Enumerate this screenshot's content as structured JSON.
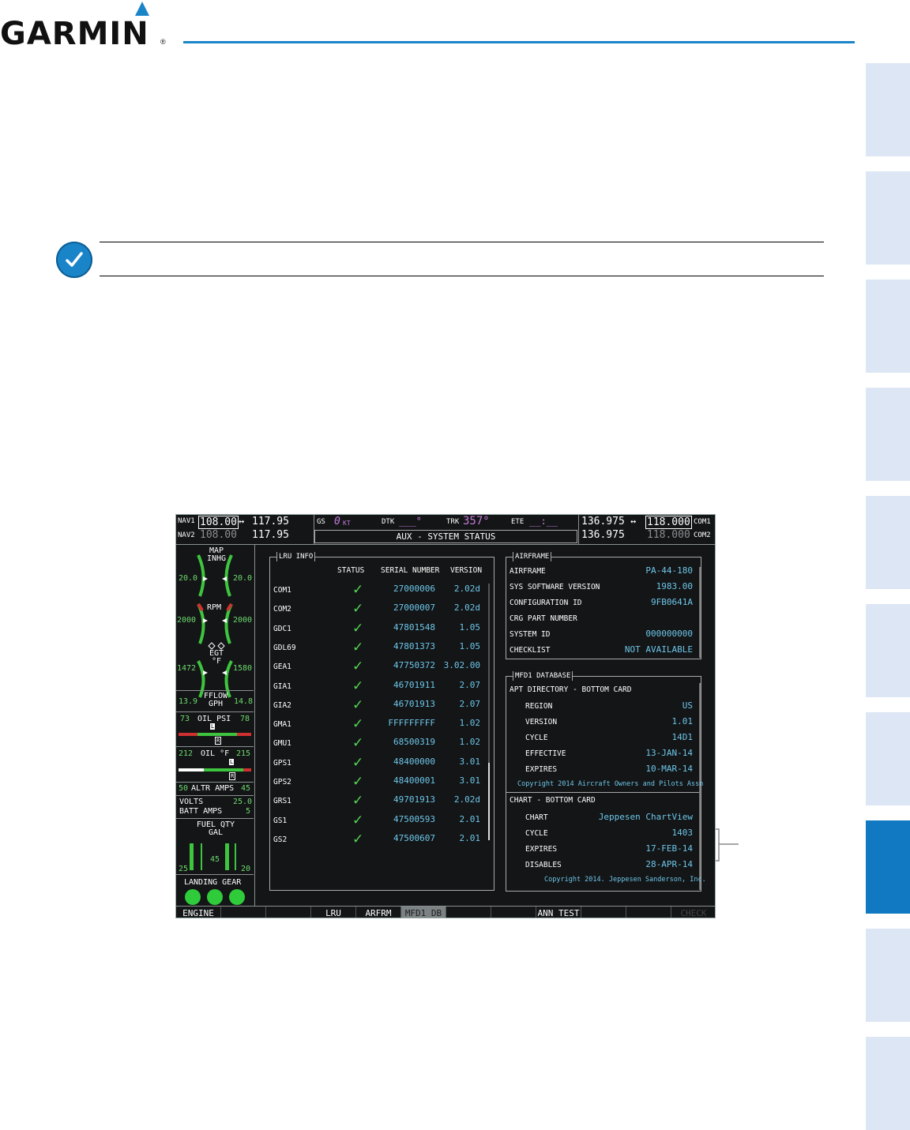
{
  "brand": {
    "name": "GARMIN",
    "reg": "®"
  },
  "colors": {
    "accent": "#1a84c8",
    "tab": "#dde6f4",
    "tab_active": "#1079c1",
    "screen_bg": "#131516",
    "cyan": "#6ec6ea",
    "magenta": "#c57ad9",
    "green": "#6fdb6f"
  },
  "icons": {
    "note": "check-mark-icon",
    "swap": "↔"
  },
  "header": {
    "nav1_label": "NAV1",
    "nav1_active": "108.00",
    "nav1_standby": "117.95",
    "nav2_label": "NAV2",
    "nav2_active": "108.00",
    "nav2_standby": "117.95",
    "gs_label": "GS",
    "gs_value": "0",
    "gs_unit": "KT",
    "dtk_label": "DTK",
    "dtk_value": "___°",
    "trk_label": "TRK",
    "trk_value": "357°",
    "ete_label": "ETE",
    "ete_value": "__:__",
    "com1_standby": "136.975",
    "com1_active": "118.000",
    "com1_label": "COM1",
    "com2_standby": "136.975",
    "com2_active": "118.000",
    "com2_label": "COM2",
    "page_title": "AUX - SYSTEM STATUS"
  },
  "eis": {
    "map_inhg_label": "MAP\nINHG",
    "map_left": "20.0",
    "map_right": "20.0",
    "rpm_label": "RPM",
    "rpm_left": "2000",
    "rpm_right": "2000",
    "egt_label": "EGT\n°F",
    "egt_left": "1472",
    "egt_right": "1580",
    "fflow_label": "FFLOW\nGPH",
    "fflow_left": "13.9",
    "fflow_right": "14.8",
    "oilpsi_left": "73",
    "oilpsi_label": "OIL PSI",
    "oilpsi_right": "78",
    "oiltemp_left": "212",
    "oiltemp_label": "OIL °F",
    "oiltemp_right": "215",
    "marker_l": "L",
    "marker_r": "R",
    "altr_left": "50",
    "altr_label": "ALTR AMPS",
    "altr_right": "45",
    "volts_label": "VOLTS",
    "volts_value": "25.0",
    "batt_label": "BATT AMPS",
    "batt_value": "5",
    "fuel_label": "FUEL QTY\nGAL",
    "fuel_left": "25",
    "fuel_mid": "45",
    "fuel_right": "20",
    "gear_label": "LANDING GEAR"
  },
  "lru": {
    "title": "LRU INFO",
    "headers": {
      "status": "STATUS",
      "serial": "SERIAL NUMBER",
      "version": "VERSION"
    },
    "rows": [
      {
        "name": "COM1",
        "serial": "27000006",
        "version": "2.02d"
      },
      {
        "name": "COM2",
        "serial": "27000007",
        "version": "2.02d"
      },
      {
        "name": "GDC1",
        "serial": "47801548",
        "version": "1.05"
      },
      {
        "name": "GDL69",
        "serial": "47801373",
        "version": "1.05"
      },
      {
        "name": "GEA1",
        "serial": "47750372",
        "version": "3.02.00"
      },
      {
        "name": "GIA1",
        "serial": "46701911",
        "version": "2.07"
      },
      {
        "name": "GIA2",
        "serial": "46701913",
        "version": "2.07"
      },
      {
        "name": "GMA1",
        "serial": "FFFFFFFFF",
        "version": "1.02"
      },
      {
        "name": "GMU1",
        "serial": "68500319",
        "version": "1.02"
      },
      {
        "name": "GPS1",
        "serial": "48400000",
        "version": "3.01"
      },
      {
        "name": "GPS2",
        "serial": "48400001",
        "version": "3.01"
      },
      {
        "name": "GRS1",
        "serial": "49701913",
        "version": "2.02d"
      },
      {
        "name": "GS1",
        "serial": "47500593",
        "version": "2.01"
      },
      {
        "name": "GS2",
        "serial": "47500607",
        "version": "2.01"
      }
    ]
  },
  "airframe": {
    "title": "AIRFRAME",
    "rows": [
      {
        "label": "AIRFRAME",
        "value": "PA-44-180"
      },
      {
        "label": "SYS SOFTWARE VERSION",
        "value": "1983.00"
      },
      {
        "label": "CONFIGURATION ID",
        "value": "9FB0641A"
      },
      {
        "label": "CRG PART NUMBER",
        "value": ""
      },
      {
        "label": "SYSTEM ID",
        "value": "000000000"
      },
      {
        "label": "CHECKLIST",
        "value": "NOT AVAILABLE"
      }
    ]
  },
  "mfd_db": {
    "title": "MFD1 DATABASE",
    "apt_header": "APT DIRECTORY - BOTTOM CARD",
    "apt_rows": [
      {
        "label": "REGION",
        "value": "US"
      },
      {
        "label": "VERSION",
        "value": "1.01"
      },
      {
        "label": "CYCLE",
        "value": "14D1"
      },
      {
        "label": "EFFECTIVE",
        "value": "13-JAN-14"
      },
      {
        "label": "EXPIRES",
        "value": "10-MAR-14"
      }
    ],
    "apt_copyright": "Copyright 2014 Aircraft Owners and Pilots Assn",
    "chart_header": "CHART - BOTTOM CARD",
    "chart_rows": [
      {
        "label": "CHART",
        "value": "Jeppesen ChartView"
      },
      {
        "label": "CYCLE",
        "value": "1403"
      },
      {
        "label": "EXPIRES",
        "value": "17-FEB-14"
      },
      {
        "label": "DISABLES",
        "value": "28-APR-14"
      }
    ],
    "chart_copyright": "Copyright 2014. Jeppesen Sanderson, Inc."
  },
  "softkeys": [
    "ENGINE",
    "",
    "",
    "LRU",
    "ARFRM",
    "MFD1 DB",
    "",
    "",
    "ANN TEST",
    "",
    "",
    "CHECK"
  ]
}
